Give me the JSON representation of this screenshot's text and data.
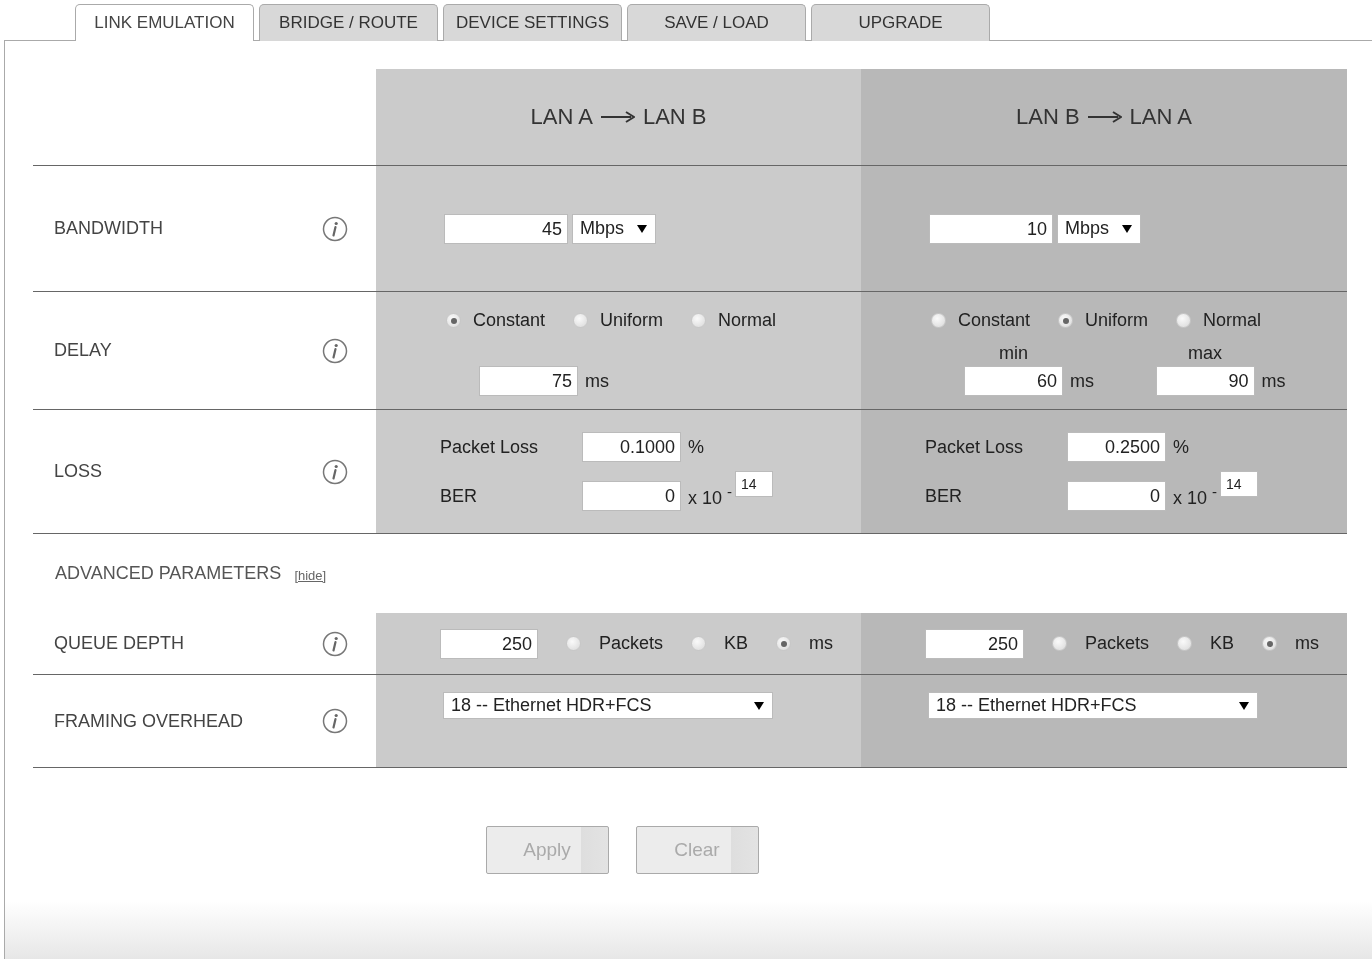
{
  "tabs": [
    {
      "label": "LINK EMULATION",
      "selected": true
    },
    {
      "label": "BRIDGE / ROUTE",
      "selected": false
    },
    {
      "label": "DEVICE SETTINGS",
      "selected": false
    },
    {
      "label": "SAVE / LOAD",
      "selected": false
    },
    {
      "label": "UPGRADE",
      "selected": false
    }
  ],
  "directions": [
    {
      "from": "LAN A",
      "to": "LAN B"
    },
    {
      "from": "LAN B",
      "to": "LAN A"
    }
  ],
  "bandwidth": {
    "label": "BANDWIDTH",
    "directions": [
      {
        "value": "45",
        "unit": "Mbps"
      },
      {
        "value": "10",
        "unit": "Mbps"
      }
    ]
  },
  "delay": {
    "label": "DELAY",
    "directions": [
      {
        "options": [
          {
            "label": "Constant",
            "selected": true
          },
          {
            "label": "Uniform",
            "selected": false
          },
          {
            "label": "Normal",
            "selected": false
          }
        ],
        "fields": [
          {
            "value": "75",
            "unit": "ms"
          }
        ]
      },
      {
        "options": [
          {
            "label": "Constant",
            "selected": false
          },
          {
            "label": "Uniform",
            "selected": true
          },
          {
            "label": "Normal",
            "selected": false
          }
        ],
        "fields": [
          {
            "caption": "min",
            "value": "60",
            "unit": "ms"
          },
          {
            "caption": "max",
            "value": "90",
            "unit": "ms"
          }
        ]
      }
    ]
  },
  "loss": {
    "label": "LOSS",
    "directions": [
      {
        "packet_loss_label": "Packet Loss",
        "packet_loss": "0.1000",
        "packet_loss_unit": "%",
        "ber_label": "BER",
        "ber": "0",
        "ber_multiplier": "x 10 $^{-}$",
        "ber_exponent": "14"
      },
      {
        "packet_loss_label": "Packet Loss",
        "packet_loss": "0.2500",
        "packet_loss_unit": "%",
        "ber_label": "BER",
        "ber": "0",
        "ber_multiplier": "x 10 $^{-}$",
        "ber_exponent": "14"
      }
    ]
  },
  "advanced": {
    "title": "ADVANCED PARAMETERS",
    "toggle": "[hide]"
  },
  "queue_depth": {
    "label": "QUEUE DEPTH",
    "directions": [
      {
        "value": "250",
        "options": [
          {
            "label": "Packets",
            "selected": false
          },
          {
            "label": "KB",
            "selected": false
          },
          {
            "label": "ms",
            "selected": true
          }
        ]
      },
      {
        "value": "250",
        "options": [
          {
            "label": "Packets",
            "selected": false
          },
          {
            "label": "KB",
            "selected": false
          },
          {
            "label": "ms",
            "selected": true
          }
        ]
      }
    ]
  },
  "framing_overhead": {
    "label": "FRAMING OVERHEAD",
    "directions": [
      {
        "value": "18 -- Ethernet HDR+FCS"
      },
      {
        "value": "18 -- Ethernet HDR+FCS"
      }
    ]
  },
  "buttons": [
    {
      "label": "Apply",
      "disabled": true
    },
    {
      "label": "Clear",
      "disabled": true
    }
  ]
}
